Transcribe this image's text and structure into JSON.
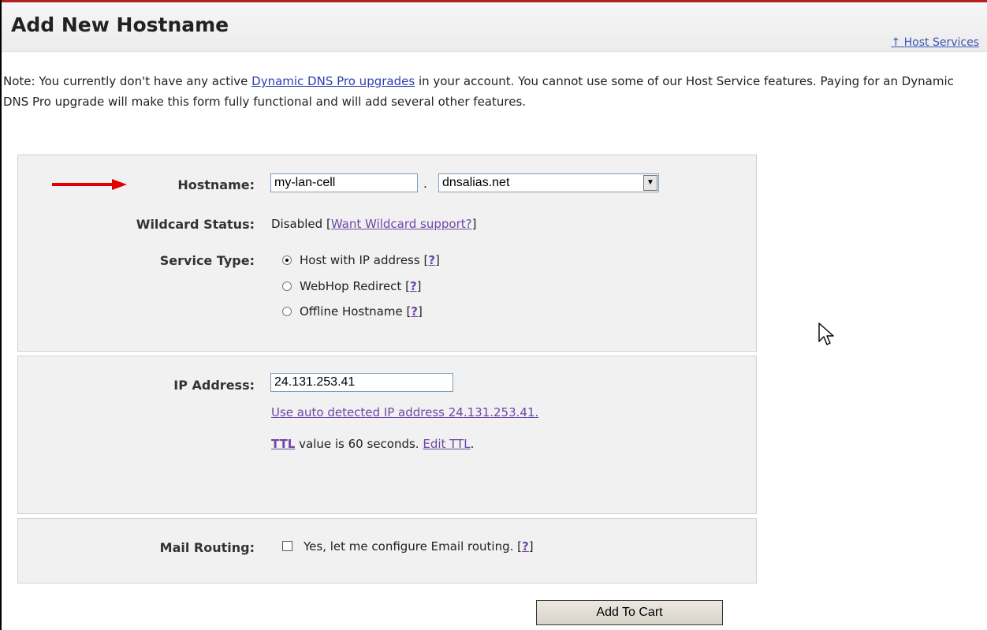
{
  "header": {
    "title": "Add New Hostname",
    "host_services_link": "↑ Host Services"
  },
  "note": {
    "prefix": "Note: You currently don't have any active ",
    "link": "Dynamic DNS Pro upgrades",
    "suffix": " in your account. You cannot use some of our Host Service features. Paying for an Dynamic DNS Pro upgrade will make this form fully functional and will add several other features."
  },
  "hostname": {
    "label": "Hostname:",
    "value": "my-lan-cell",
    "separator": ".",
    "domain_selected": "dnsalias.net"
  },
  "wildcard": {
    "label": "Wildcard Status:",
    "status": "Disabled",
    "bracket_open": "[",
    "link": "Want Wildcard support?",
    "bracket_close": "]"
  },
  "service_type": {
    "label": "Service Type:",
    "options": [
      {
        "label": "Host with IP address",
        "help": "?",
        "selected": true
      },
      {
        "label": "WebHop Redirect",
        "help": "?",
        "selected": false
      },
      {
        "label": "Offline Hostname",
        "help": "?",
        "selected": false
      }
    ]
  },
  "ip": {
    "label": "IP Address:",
    "value": "24.131.253.41",
    "auto_link": "Use auto detected IP address 24.131.253.41.",
    "ttl_link": "TTL",
    "ttl_text": " value is 60 seconds. ",
    "edit_ttl_link": "Edit TTL",
    "ttl_period": "."
  },
  "mail": {
    "label": "Mail Routing:",
    "checkbox_label": "Yes, let me configure Email routing.",
    "help": "?"
  },
  "actions": {
    "add_to_cart": "Add To Cart"
  },
  "colors": {
    "accent_red": "#e00000",
    "link_blue": "#2d3fae",
    "link_visited": "#6e47a8"
  }
}
